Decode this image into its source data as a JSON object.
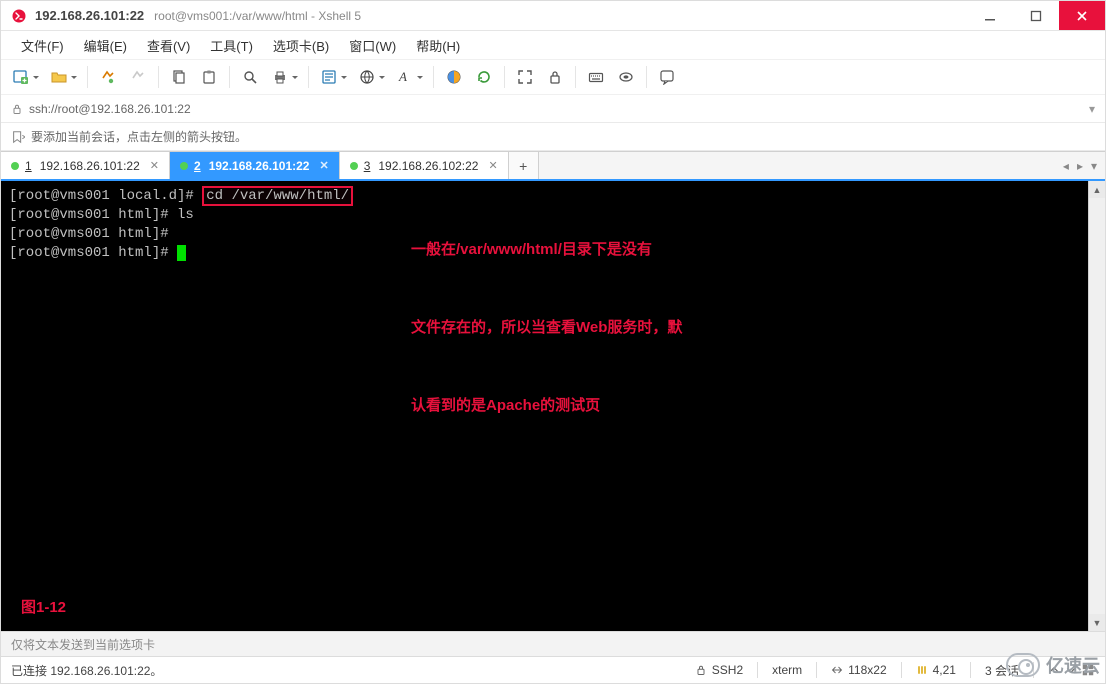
{
  "window": {
    "title": "192.168.26.101:22",
    "subtitle": "root@vms001:/var/www/html - Xshell 5"
  },
  "menu": {
    "items": [
      "文件(F)",
      "编辑(E)",
      "查看(V)",
      "工具(T)",
      "选项卡(B)",
      "窗口(W)",
      "帮助(H)"
    ]
  },
  "address": {
    "scheme_icon": "lock-icon",
    "url": "ssh://root@192.168.26.101:22"
  },
  "hint": "要添加当前会话，点击左侧的箭头按钮。",
  "tabs": [
    {
      "num": "1",
      "label": "192.168.26.101:22",
      "active": false
    },
    {
      "num": "2",
      "label": "192.168.26.101:22",
      "active": true
    },
    {
      "num": "3",
      "label": "192.168.26.102:22",
      "active": false
    }
  ],
  "terminal": {
    "lines": {
      "l1_prompt": "[root@vms001 local.d]#",
      "l1_cmd": "cd /var/www/html/",
      "l2": "[root@vms001 html]# ls",
      "l3": "[root@vms001 html]#",
      "l4": "[root@vms001 html]# "
    },
    "annotation": {
      "line1": "一般在/var/www/html/目录下是没有",
      "line2": "文件存在的，所以当查看Web服务时，默",
      "line3": "认看到的是Apache的测试页",
      "figure": "图1-12"
    }
  },
  "composer": {
    "placeholder": "仅将文本发送到当前选项卡"
  },
  "status": {
    "conn": "已连接 192.168.26.101:22。",
    "proto": "SSH2",
    "termtype": "xterm",
    "size": "118x22",
    "pos": "4,21",
    "sessions": "3 会话"
  },
  "watermark": "亿速云"
}
